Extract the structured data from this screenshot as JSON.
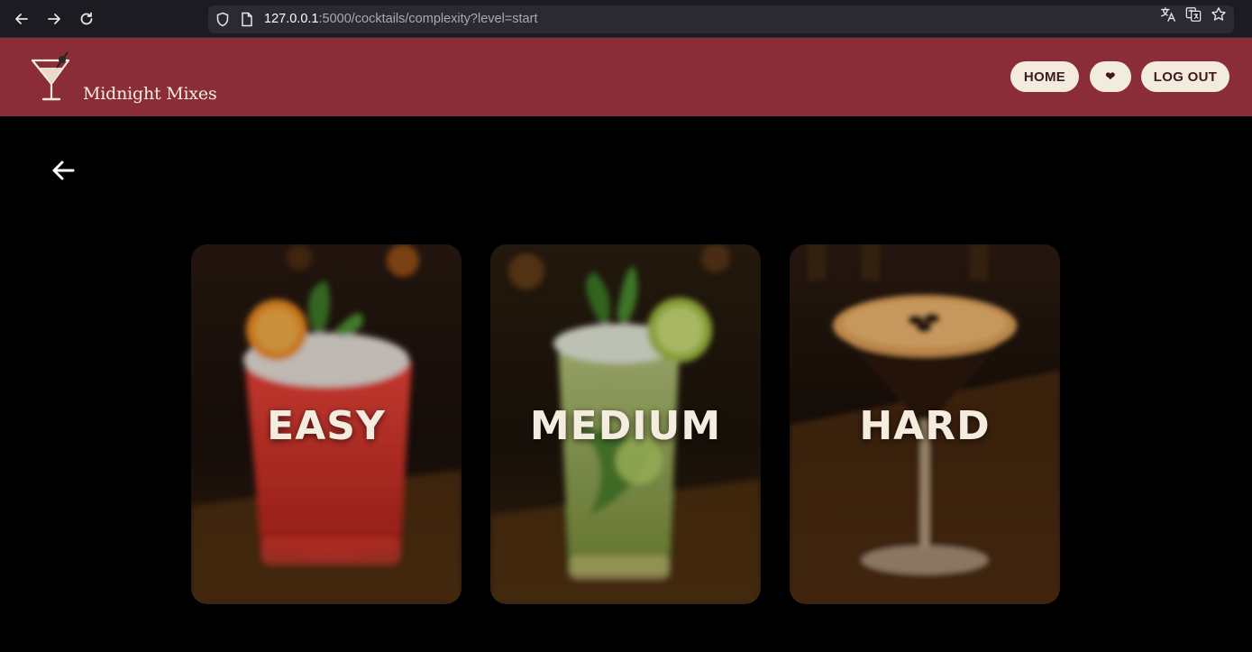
{
  "browser": {
    "url_host": "127.0.0.1",
    "url_rest": ":5000/cocktails/complexity?level=start"
  },
  "header": {
    "brand": "Midnight Mixes",
    "nav": {
      "home": "HOME",
      "favorites": "❤",
      "logout": "LOG OUT"
    }
  },
  "cards": [
    {
      "label": "EASY"
    },
    {
      "label": "MEDIUM"
    },
    {
      "label": "HARD"
    }
  ],
  "colors": {
    "header_bg": "#8a2d38",
    "pill_bg": "#f3ebde",
    "pill_text": "#3e1a1e",
    "page_bg": "#000000"
  }
}
